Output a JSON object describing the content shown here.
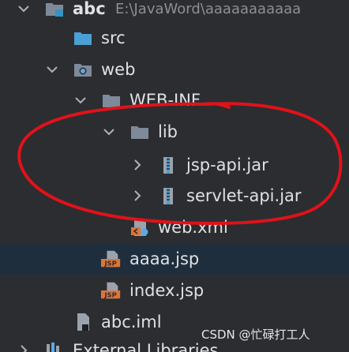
{
  "project_tree": {
    "root": {
      "label": "abc",
      "path": "E:\\JavaWord\\aaaaaaaaaaa"
    },
    "items": [
      {
        "label": "src"
      },
      {
        "label": "web"
      },
      {
        "label": "WEB-INF"
      },
      {
        "label": "lib"
      },
      {
        "label": "jsp-api.jar"
      },
      {
        "label": "servlet-api.jar"
      },
      {
        "label": "web.xml"
      },
      {
        "label": "aaaa.jsp"
      },
      {
        "label": "index.jsp"
      },
      {
        "label": "abc.iml"
      }
    ],
    "external_libraries": {
      "label": "External Libraries"
    }
  },
  "icons": {
    "folder": "folder-icon",
    "web_folder": "web-folder-icon",
    "jar": "jar-icon",
    "jsp": "jsp-file-icon",
    "xml": "xml-file-icon",
    "iml": "iml-file-icon",
    "libraries": "libraries-icon"
  },
  "jsp_badge_text": "JSP",
  "colors": {
    "background": "#2b2d30",
    "selection": "#1f2e3d",
    "text": "#dfe1e5",
    "path_text": "#8c8f94",
    "folder": "#7e8a99",
    "jsp_orange": "#d9763a",
    "annotation_red": "#e0121a"
  },
  "watermark": "CSDN @忙碌打工人"
}
